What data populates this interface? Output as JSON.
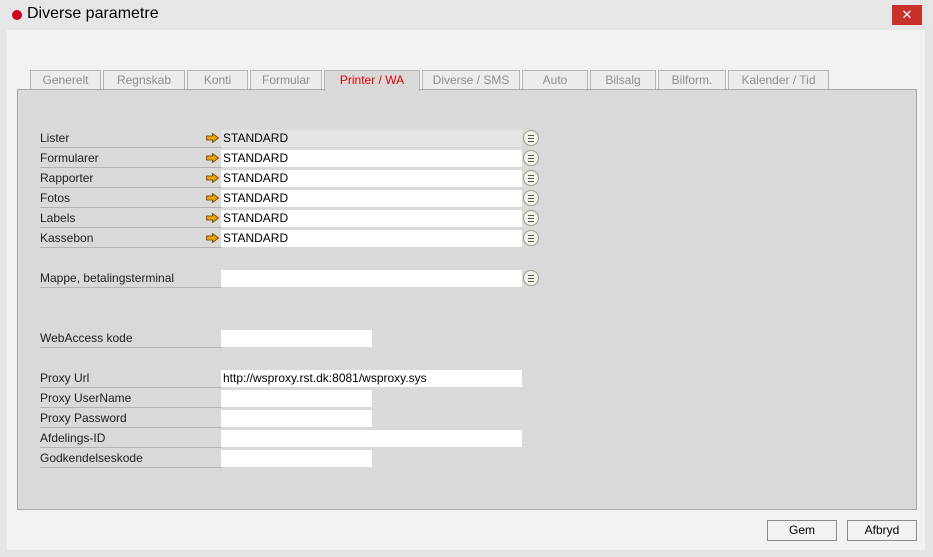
{
  "window": {
    "title": "Diverse parametre",
    "close_glyph": "✕"
  },
  "tabs": [
    {
      "label": "Generelt"
    },
    {
      "label": "Regnskab"
    },
    {
      "label": "Konti"
    },
    {
      "label": "Formular"
    },
    {
      "label": "Printer / WA",
      "active": true
    },
    {
      "label": "Diverse / SMS"
    },
    {
      "label": "Auto"
    },
    {
      "label": "Bilsalg"
    },
    {
      "label": "Bilform."
    },
    {
      "label": "Kalender / Tid"
    }
  ],
  "printers": [
    {
      "label": "Lister",
      "value": "STANDARD"
    },
    {
      "label": "Formularer",
      "value": "STANDARD"
    },
    {
      "label": "Rapporter",
      "value": "STANDARD"
    },
    {
      "label": "Fotos",
      "value": "STANDARD"
    },
    {
      "label": "Labels",
      "value": "STANDARD"
    },
    {
      "label": "Kassebon",
      "value": "STANDARD"
    }
  ],
  "terminal": {
    "label": "Mappe, betalingsterminal",
    "value": ""
  },
  "webaccess": {
    "label": "WebAccess kode",
    "value": ""
  },
  "proxy": {
    "url_label": "Proxy Url",
    "url_value": "http://wsproxy.rst.dk:8081/wsproxy.sys",
    "user_label": "Proxy UserName",
    "user_value": "",
    "password_label": "Proxy Password",
    "password_value": "",
    "afdeling_label": "Afdelings-ID",
    "afdeling_value": "",
    "godkend_label": "Godkendelseskode",
    "godkend_value": ""
  },
  "buttons": {
    "save": "Gem",
    "cancel": "Afbryd"
  },
  "colors": {
    "accent_red": "#e00000",
    "title_dot": "#d0021b",
    "close_bg": "#c8302c",
    "arrow": "#f5a300"
  }
}
